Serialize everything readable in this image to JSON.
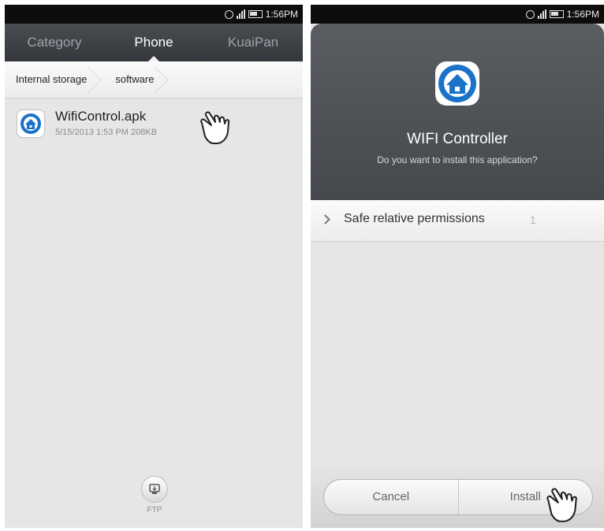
{
  "left_screen": {
    "status_time": "1:56PM",
    "tabs": [
      {
        "label": "Category",
        "active": false
      },
      {
        "label": "Phone",
        "active": true
      },
      {
        "label": "KuaiPan",
        "active": false
      }
    ],
    "breadcrumb": [
      "Internal storage",
      "software"
    ],
    "file": {
      "name": "WifiControl.apk",
      "meta": "5/15/2013 1:53 PM 208KB"
    },
    "ftp_label": "FTP"
  },
  "right_screen": {
    "status_time": "1:56PM",
    "app_name": "WIFI Controller",
    "prompt": "Do you want to install this application?",
    "permissions": {
      "label": "Safe relative permissions",
      "count": "1"
    },
    "cancel_label": "Cancel",
    "install_label": "Install"
  },
  "colors": {
    "accent": "#1a73c9",
    "header": "#4f5257",
    "background": "#e6e6e6"
  },
  "icons": [
    "alarm-icon",
    "signal-icon",
    "battery-icon",
    "app-house-icon",
    "ftp-icon",
    "pointer-hand-icon",
    "chevron-right-icon"
  ]
}
